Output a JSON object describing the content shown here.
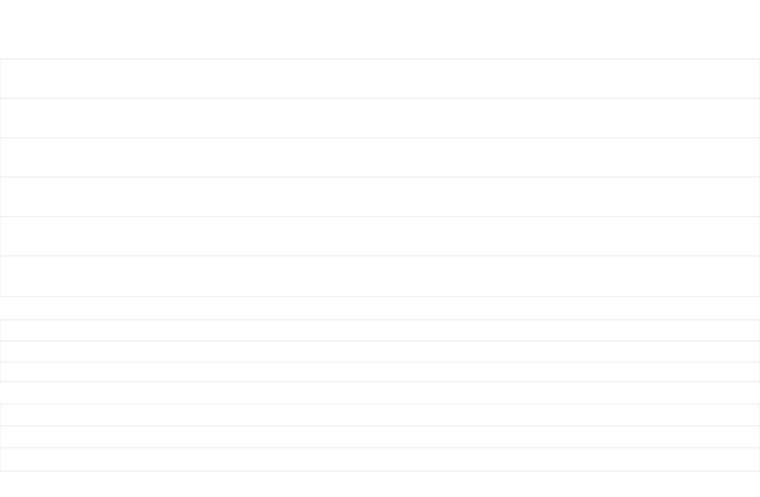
{
  "chart_data": [
    {
      "type": "candlestick",
      "candles": [],
      "series": []
    },
    {
      "type": "bar",
      "values": [],
      "series": []
    },
    {
      "type": "bar",
      "values": [],
      "series": []
    }
  ]
}
